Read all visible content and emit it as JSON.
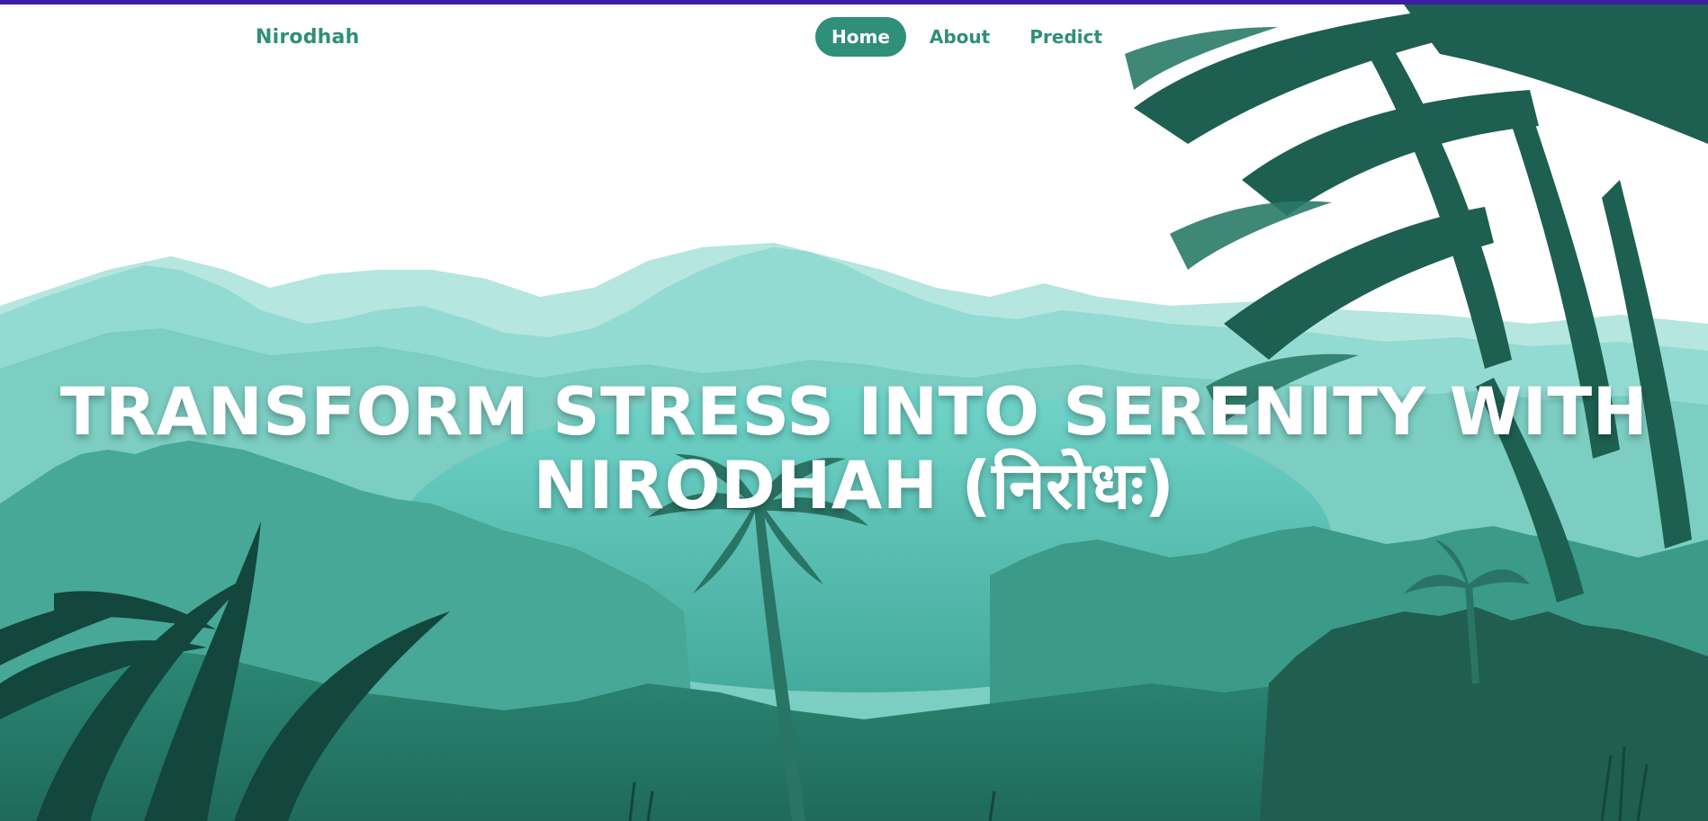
{
  "nav": {
    "brand": "Nirodhah",
    "links": [
      {
        "label": "Home",
        "active": true
      },
      {
        "label": "About",
        "active": false
      },
      {
        "label": "Predict",
        "active": false
      }
    ]
  },
  "hero": {
    "headline_line1": "TRANSFORM STRESS INTO SERENITY WITH",
    "headline_line2": "NIRODHAH (निरोधः)"
  },
  "colors": {
    "accent": "#2f8f79",
    "top_strip": "#3a1fa4",
    "headline": "#ffffff"
  }
}
